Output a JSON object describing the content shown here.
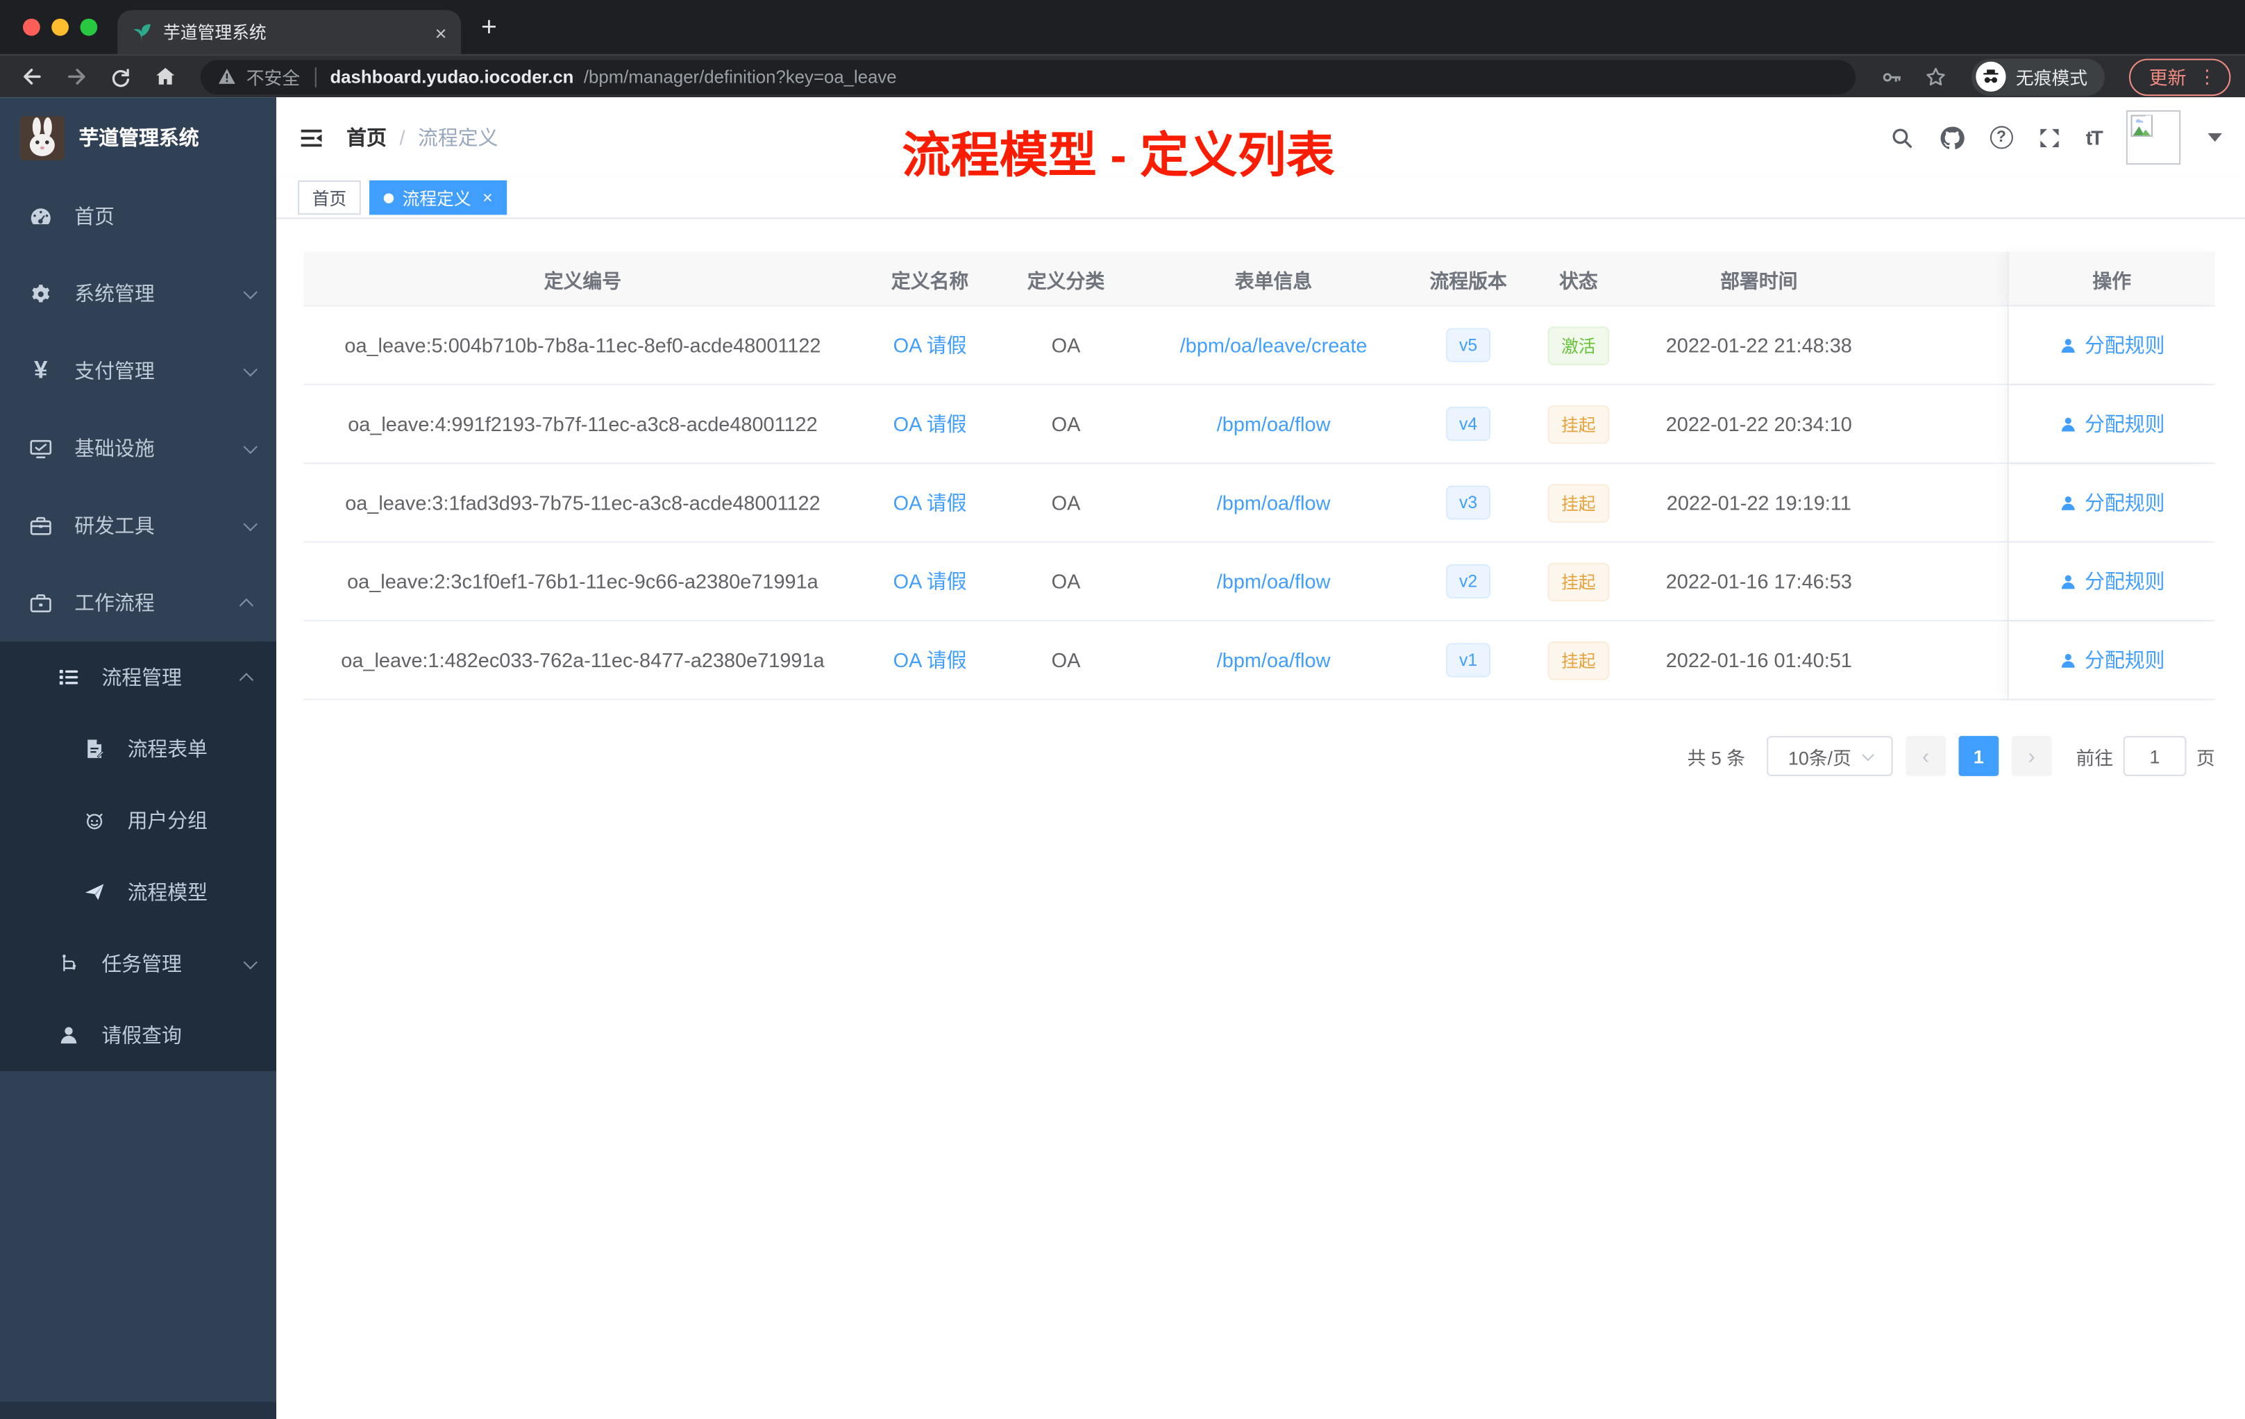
{
  "browser": {
    "tab_title": "芋道管理系统",
    "new_tab_glyph": "+",
    "close_glyph": "×",
    "security_label": "不安全",
    "url_host": "dashboard.yudao.iocoder.cn",
    "url_path": "/bpm/manager/definition?key=oa_leave",
    "incognito_label": "无痕模式",
    "update_label": "更新",
    "more_glyph": "⋮"
  },
  "sidebar": {
    "logo_title": "芋道管理系统",
    "items": [
      {
        "label": "首页",
        "icon": "dashboard-icon",
        "chevron": ""
      },
      {
        "label": "系统管理",
        "icon": "gear-icon",
        "chevron": "down"
      },
      {
        "label": "支付管理",
        "icon": "yen-icon",
        "chevron": "down"
      },
      {
        "label": "基础设施",
        "icon": "monitor-icon",
        "chevron": "down"
      },
      {
        "label": "研发工具",
        "icon": "toolbox-icon",
        "chevron": "down"
      },
      {
        "label": "工作流程",
        "icon": "briefcase-icon",
        "chevron": "up"
      }
    ],
    "submenu": {
      "process_mgmt": {
        "label": "流程管理",
        "icon": "list-icon",
        "chevron": "up"
      },
      "children": [
        {
          "label": "流程表单",
          "icon": "form-icon"
        },
        {
          "label": "用户分组",
          "icon": "robot-icon"
        },
        {
          "label": "流程模型",
          "icon": "paper-plane-icon"
        }
      ],
      "task_mgmt": {
        "label": "任务管理",
        "icon": "tree-icon",
        "chevron": "down"
      },
      "leave_query": {
        "label": "请假查询",
        "icon": "user-icon"
      }
    }
  },
  "header": {
    "breadcrumb": {
      "home": "首页",
      "separator": "/",
      "current": "流程定义"
    },
    "annotation": "流程模型 - 定义列表",
    "annotation_color": "#fb1d02",
    "help_glyph": "?",
    "font_size_glyph": "tT"
  },
  "tags": {
    "home": "首页",
    "active": "流程定义",
    "close_glyph": "×"
  },
  "table": {
    "columns": [
      "定义编号",
      "定义名称",
      "定义分类",
      "表单信息",
      "流程版本",
      "状态",
      "部署时间",
      "操作"
    ],
    "action_label": "分配规则",
    "rows": [
      {
        "id": "oa_leave:5:004b710b-7b8a-11ec-8ef0-acde48001122",
        "name": "OA 请假",
        "category": "OA",
        "form": "/bpm/oa/leave/create",
        "version": "v5",
        "status": "激活",
        "status_type": "active",
        "deploy_time": "2022-01-22 21:48:38"
      },
      {
        "id": "oa_leave:4:991f2193-7b7f-11ec-a3c8-acde48001122",
        "name": "OA 请假",
        "category": "OA",
        "form": "/bpm/oa/flow",
        "version": "v4",
        "status": "挂起",
        "status_type": "suspend",
        "deploy_time": "2022-01-22 20:34:10"
      },
      {
        "id": "oa_leave:3:1fad3d93-7b75-11ec-a3c8-acde48001122",
        "name": "OA 请假",
        "category": "OA",
        "form": "/bpm/oa/flow",
        "version": "v3",
        "status": "挂起",
        "status_type": "suspend",
        "deploy_time": "2022-01-22 19:19:11"
      },
      {
        "id": "oa_leave:2:3c1f0ef1-76b1-11ec-9c66-a2380e71991a",
        "name": "OA 请假",
        "category": "OA",
        "form": "/bpm/oa/flow",
        "version": "v2",
        "status": "挂起",
        "status_type": "suspend",
        "deploy_time": "2022-01-16 17:46:53"
      },
      {
        "id": "oa_leave:1:482ec033-762a-11ec-8477-a2380e71991a",
        "name": "OA 请假",
        "category": "OA",
        "form": "/bpm/oa/flow",
        "version": "v1",
        "status": "挂起",
        "status_type": "suspend",
        "deploy_time": "2022-01-16 01:40:51"
      }
    ]
  },
  "pagination": {
    "total_label": "共 5 条",
    "page_size": "10条/页",
    "prev_glyph": "‹",
    "next_glyph": "›",
    "current_page": "1",
    "goto_label": "前往",
    "goto_value": "1",
    "page_unit": "页"
  },
  "colors": {
    "primary": "#409eff",
    "status_active": "#67c23a",
    "status_suspend": "#e6a23c",
    "sidebar_bg": "#304156",
    "submenu_bg": "#1f2d3d",
    "annotation_red": "#fb1d02"
  }
}
